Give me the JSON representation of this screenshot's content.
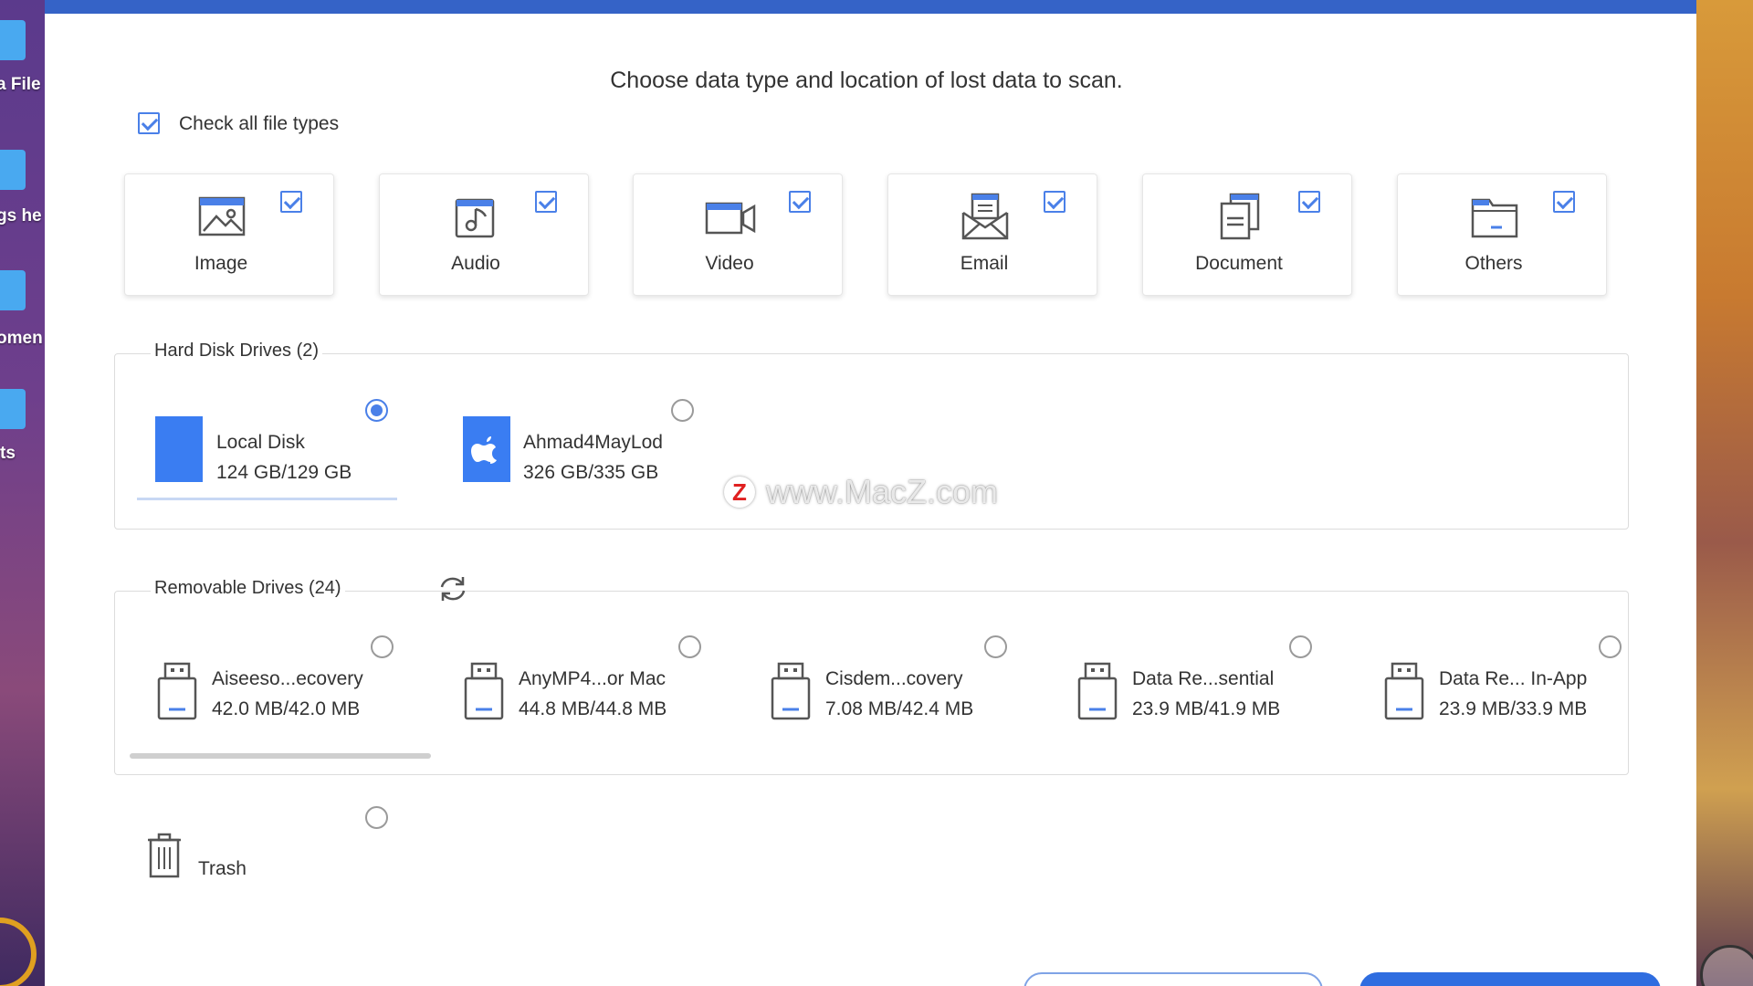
{
  "desktop": {
    "labels": [
      "a File",
      "gs he",
      "omen",
      "ts"
    ]
  },
  "heading": "Choose data type and location of lost data to scan.",
  "check_all_label": "Check all file types",
  "file_types": [
    {
      "label": "Image",
      "checked": true,
      "icon": "image-icon"
    },
    {
      "label": "Audio",
      "checked": true,
      "icon": "audio-icon"
    },
    {
      "label": "Video",
      "checked": true,
      "icon": "video-icon"
    },
    {
      "label": "Email",
      "checked": true,
      "icon": "email-icon"
    },
    {
      "label": "Document",
      "checked": true,
      "icon": "document-icon"
    },
    {
      "label": "Others",
      "checked": true,
      "icon": "folder-icon"
    }
  ],
  "hard_disks": {
    "title": "Hard Disk Drives (2)",
    "drives": [
      {
        "name": "Local Disk",
        "size": "124 GB/129 GB",
        "selected": true
      },
      {
        "name": "Ahmad4MayLod",
        "size": "326 GB/335 GB",
        "selected": false
      }
    ]
  },
  "removable": {
    "title": "Removable Drives (24)",
    "drives": [
      {
        "name": "Aiseeso...ecovery",
        "size": "42.0 MB/42.0 MB"
      },
      {
        "name": "AnyMP4...or Mac",
        "size": "44.8 MB/44.8 MB"
      },
      {
        "name": "Cisdem...covery",
        "size": "7.08 MB/42.4 MB"
      },
      {
        "name": "Data Re...sential",
        "size": "23.9 MB/41.9 MB"
      },
      {
        "name": "Data Re... In-App",
        "size": "23.9 MB/33.9 MB"
      }
    ]
  },
  "trash": {
    "label": "Trash"
  },
  "watermark": {
    "badge": "Z",
    "text": "www.MacZ.com"
  },
  "colors": {
    "accent": "#3563c7",
    "drive_blue": "#3a7df2",
    "check_blue": "#4a80e8"
  }
}
